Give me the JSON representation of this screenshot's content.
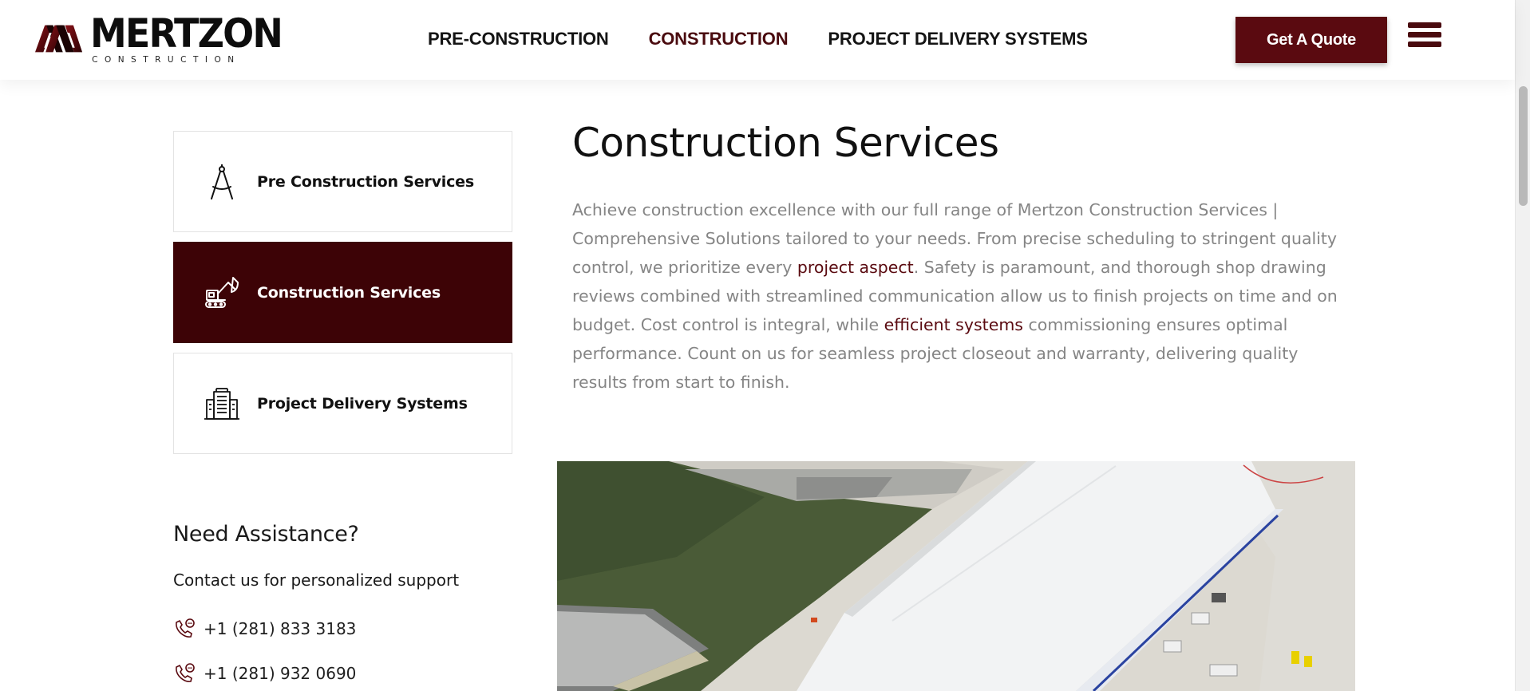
{
  "header": {
    "logo": {
      "name": "MERTZON",
      "tagline": "CONSTRUCTION"
    },
    "nav": [
      {
        "label": "PRE-CONSTRUCTION",
        "active": false
      },
      {
        "label": "CONSTRUCTION",
        "active": true
      },
      {
        "label": "PROJECT DELIVERY SYSTEMS",
        "active": false
      }
    ],
    "cta_label": "Get A Quote",
    "menu_icon": "hamburger-icon"
  },
  "sidebar": {
    "services": [
      {
        "label": "Pre Construction Services",
        "icon": "compass-icon",
        "active": false
      },
      {
        "label": "Construction Services",
        "icon": "excavator-icon",
        "active": true
      },
      {
        "label": "Project Delivery Systems",
        "icon": "building-icon",
        "active": false
      }
    ],
    "assistance": {
      "title": "Need Assistance?",
      "subtitle": "Contact us for personalized support",
      "phones": [
        "+1 (281) 833 3183",
        "+1 (281) 932 0690"
      ]
    }
  },
  "main": {
    "title": "Construction Services",
    "desc_part1": "Achieve construction excellence with our full range of Mertzon Construction Services | Comprehensive Solutions tailored to your needs. From precise scheduling to stringent quality control, we prioritize every ",
    "desc_link1": "project aspect",
    "desc_part2": ". Safety is paramount, and thorough shop drawing reviews combined with streamlined communication allow us to finish projects on time and on budget. Cost control is integral, while ",
    "desc_link2": "efficient systems",
    "desc_part3": " commissioning ensures optimal performance. Count on us for seamless project closeout and warranty, delivering quality results from start to finish."
  },
  "colors": {
    "brand": "#5a0a10",
    "active_card": "#3d0306",
    "body_text": "#858585"
  }
}
